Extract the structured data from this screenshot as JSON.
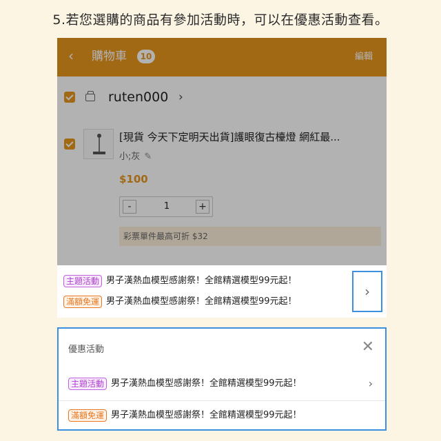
{
  "caption": "5.若您選購的商品有參加活動時，可以在優惠活動查看。",
  "header": {
    "back_icon": "‹",
    "title": "購物車",
    "count": "10",
    "edit_label": "編輯"
  },
  "shop": {
    "name": "ruten000",
    "arrow": "›"
  },
  "product": {
    "title": "[現貨 今天下定明天出貨]護眼復古檯燈 網紅最...",
    "spec": "小;灰",
    "price": "$100",
    "quantity": "1",
    "minus": "-",
    "plus": "+",
    "lottery_note": "彩票單件最高可折 $32"
  },
  "promo_strip": {
    "items": [
      {
        "tag": "主題活動",
        "text": "男子漢熱血模型感謝祭！全館精選模型99元起！"
      },
      {
        "tag": "滿額免運",
        "text": "男子漢熱血模型感謝祭！全館精選模型99元起！"
      }
    ],
    "arrow": "›"
  },
  "popup": {
    "title": "優惠活動",
    "close_icon": "✕",
    "items": [
      {
        "tag": "主題活動",
        "text": "男子漢熱血模型感謝祭！全館精選模型99元起！"
      },
      {
        "tag": "滿額免運",
        "text": "男子漢熱血模型感謝祭！全館精選模型99元起！"
      }
    ],
    "arrow": "›"
  },
  "colors": {
    "brand": "#e8971e",
    "highlight": "#3a8fe0",
    "tag_theme": "#b040d0",
    "tag_free": "#e8761e"
  }
}
